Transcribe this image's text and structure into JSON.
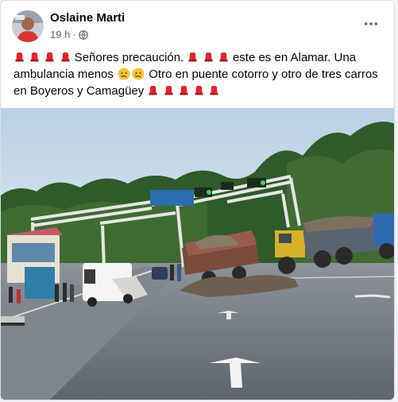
{
  "post": {
    "author": "Oslaine Marti",
    "time": "19 h",
    "separator": "·",
    "privacy_icon": "globe-icon",
    "menu_icon": "more-options-icon",
    "text_segments": [
      " Señores precaución. ",
      " este es en Alamar. Una ambulancia menos ",
      " Otro en puente cotorro y otro de tres carros en Boyeros y Camagüey "
    ],
    "emoji": {
      "siren": "police-light-emoji",
      "sad": "sad-face-emoji"
    }
  },
  "colors": {
    "siren_red": "#e3242b",
    "face_yellow": "#f7c331",
    "name_text": "#050505",
    "meta_text": "#65676b"
  }
}
